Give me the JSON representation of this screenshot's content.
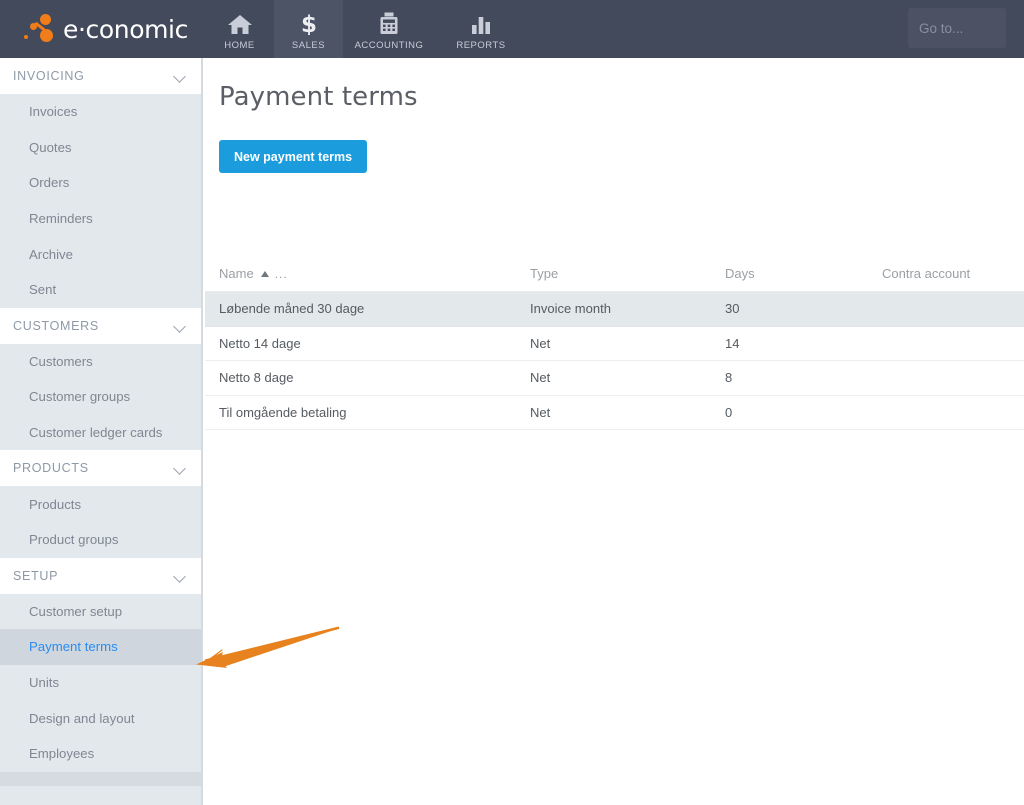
{
  "brand": {
    "name": "e·conomic",
    "logo_icon": "economic-logo-icon",
    "accent_orange": "#f07d1a",
    "topbar_bg": "#434a5c",
    "link_blue": "#2a8cf0",
    "button_blue": "#1a9cdd"
  },
  "topnav": {
    "items": [
      {
        "label": "HOME",
        "icon": "house-icon",
        "active": false
      },
      {
        "label": "SALES",
        "icon": "dollar-sign-icon",
        "active": true
      },
      {
        "label": "ACCOUNTING",
        "icon": "calculator-icon",
        "active": false
      },
      {
        "label": "REPORTS",
        "icon": "bar-chart-icon",
        "active": false
      }
    ],
    "goto_placeholder": "Go to...",
    "goto_value": ""
  },
  "sidebar": {
    "sections": [
      {
        "title": "INVOICING",
        "chevron": "chevron-down-icon",
        "items": [
          {
            "label": "Invoices",
            "active": false
          },
          {
            "label": "Quotes",
            "active": false
          },
          {
            "label": "Orders",
            "active": false
          },
          {
            "label": "Reminders",
            "active": false
          },
          {
            "label": "Archive",
            "active": false
          },
          {
            "label": "Sent",
            "active": false
          }
        ]
      },
      {
        "title": "CUSTOMERS",
        "chevron": "chevron-down-icon",
        "items": [
          {
            "label": "Customers",
            "active": false
          },
          {
            "label": "Customer groups",
            "active": false
          },
          {
            "label": "Customer ledger cards",
            "active": false
          }
        ]
      },
      {
        "title": "PRODUCTS",
        "chevron": "chevron-down-icon",
        "items": [
          {
            "label": "Products",
            "active": false
          },
          {
            "label": "Product groups",
            "active": false
          }
        ]
      },
      {
        "title": "SETUP",
        "chevron": "chevron-down-icon",
        "items": [
          {
            "label": "Customer setup",
            "active": false
          },
          {
            "label": "Payment terms",
            "active": true
          },
          {
            "label": "Units",
            "active": false
          },
          {
            "label": "Design and layout",
            "active": false
          },
          {
            "label": "Employees",
            "active": false
          }
        ]
      }
    ]
  },
  "main": {
    "page_title": "Payment terms",
    "new_button_label": "New payment terms"
  },
  "table": {
    "columns": [
      {
        "label": "Name",
        "sorted": "asc",
        "sort_icon": "sort-ascending-triangle-icon",
        "menu_icon": "column-ellipsis-icon",
        "menu_label": "..."
      },
      {
        "label": "Type",
        "sorted": "none"
      },
      {
        "label": "Days",
        "sorted": "none"
      },
      {
        "label": "Contra account",
        "sorted": "none"
      }
    ],
    "rows": [
      {
        "name": "Løbende måned 30 dage",
        "type": "Invoice month",
        "days": "30",
        "contra": "",
        "highlighted": true
      },
      {
        "name": "Netto 14 dage",
        "type": "Net",
        "days": "14",
        "contra": "",
        "highlighted": false
      },
      {
        "name": "Netto 8 dage",
        "type": "Net",
        "days": "8",
        "contra": "",
        "highlighted": false
      },
      {
        "name": "Til omgående betaling",
        "type": "Net",
        "days": "0",
        "contra": "",
        "highlighted": false
      }
    ]
  },
  "annotation": {
    "arrow_icon": "orange-arrow-pointing-left",
    "color": "#e8821e",
    "points_to": "Payment terms"
  }
}
